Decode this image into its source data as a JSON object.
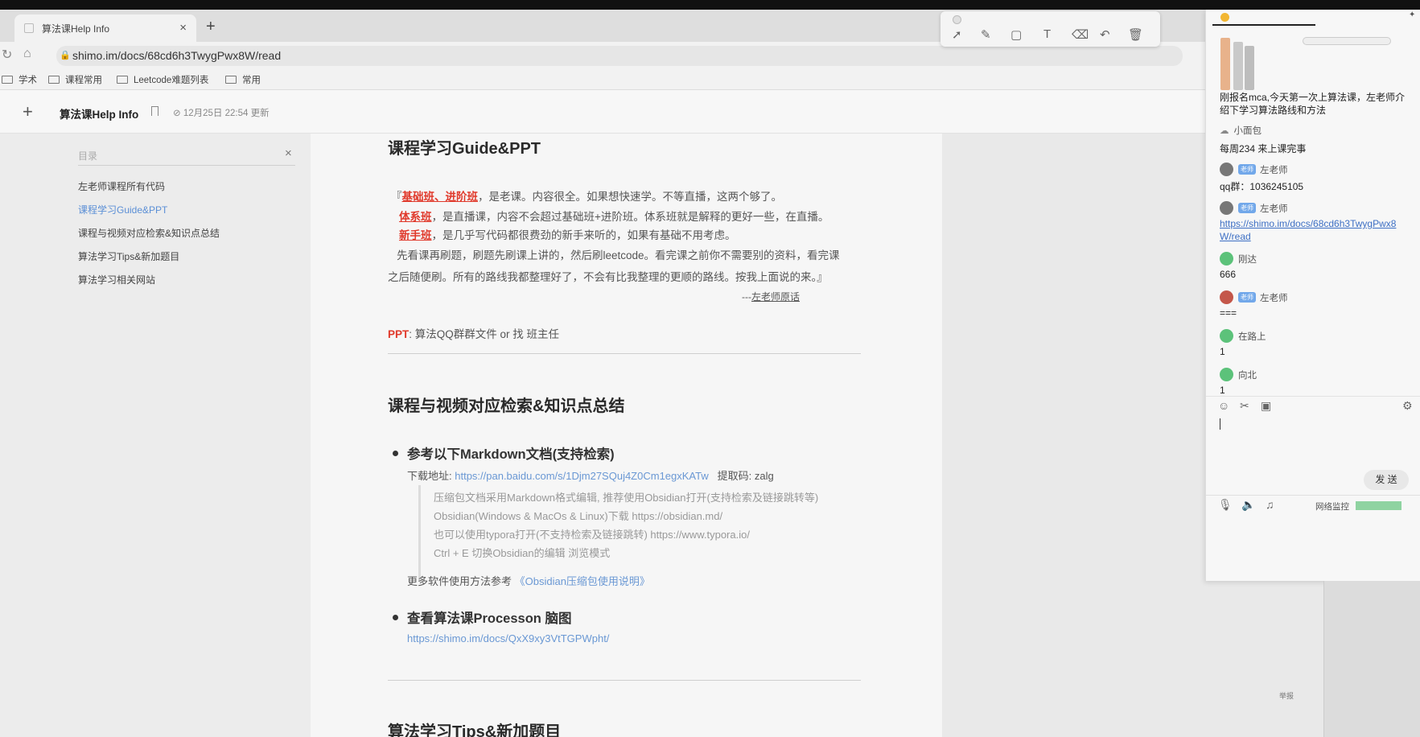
{
  "browser": {
    "tab_title": "算法课Help Info",
    "tab_close": "×",
    "new_tab": "+",
    "url": "shimo.im/docs/68cd6h3TwygPwx8W/read",
    "bookmarks": [
      "学术",
      "课程常用",
      "Leetcode难题列表",
      "常用"
    ]
  },
  "app": {
    "plus": "+",
    "title": "算法课Help Info",
    "updated": "12月25日 22:54 更新"
  },
  "toc": {
    "placeholder": "目录",
    "close": "×",
    "items": [
      "左老师课程所有代码",
      "课程学习Guide&PPT",
      "课程与视频对应检索&知识点总结",
      "算法学习Tips&新加题目",
      "算法学习相关网站"
    ],
    "active_index": 1
  },
  "doc": {
    "h_guide": "课程学习Guide&PPT",
    "q_open": "『",
    "q_basic": "基础班、进阶班",
    "q_basic_rest": "，是老课。内容很全。如果想快速学。不等直播，这两个够了。",
    "q_system": "体系班",
    "q_system_rest": "，是直播课，内容不会超过基础班+进阶班。体系班就是解释的更好一些，在直播。",
    "q_new": "新手班",
    "q_new_rest": "，是几乎写代码都很费劲的新手来听的，如果有基础不用考虑。",
    "q_line4": "先看课再刷题，刷题先刷课上讲的，然后刷leetcode。看完课之前你不需要别的资料，看完课",
    "q_line5": "之后随便刷。所有的路线我都整理好了，不会有比我整理的更顺的路线。按我上面说的来。』",
    "q_sign_dash": "---",
    "q_sign": "左老师原话",
    "ppt_label": "PPT",
    "ppt_text": ": 算法QQ群群文件 or 找 班主任",
    "h_course": "课程与视频对应检索&知识点总结",
    "b1_title": "参考以下Markdown文档(支持检索)",
    "b1_dl_label": "下载地址: ",
    "b1_dl_url": "https://pan.baidu.com/s/1Djm27SQuj4Z0Cm1egxKATw",
    "b1_code": "提取码: zalg",
    "quote1": "压缩包文档采用Markdown格式编辑, 推荐使用Obsidian打开(支持检索及链接跳转等)",
    "quote2": "Obsidian(Windows & MacOs & Linux)下载 https://obsidian.md/",
    "quote3": "也可以使用typora打开(不支持检索及链接跳转) https://www.typora.io/",
    "quote4": "Ctrl + E 切换Obsidian的编辑 浏览模式",
    "more_label": "更多软件使用方法参考 ",
    "more_link": "《Obsidian压缩包使用说明》",
    "b2_title": "查看算法课Processon 脑图",
    "b2_url": "https://shimo.im/docs/QxX9xy3VtTGPWpht/",
    "h_tips": "算法学习Tips&新加题目"
  },
  "chat": {
    "messages": [
      {
        "text": "刚报名mca,今天第一次上算法课，左老师介"
      },
      {
        "text": "绍下学习算法路线和方法"
      }
    ],
    "u1_name": "小面包",
    "u1_msg": "每周234 来上课完事",
    "teacher_badge": "老师",
    "teacher_name": "左老师",
    "t1_msg": "qq群：1036245105",
    "t2_link1": "https://shimo.im/docs/68cd6h3TwygPwx8",
    "t2_link2": "W/read",
    "u2_name": "刚达",
    "u2_msg": "666",
    "t3_msg": "===",
    "u3_name": "在路上",
    "u3_msg": "1",
    "u4_name": "向北",
    "u4_msg": "1",
    "send": "发 送",
    "netmon": "网络监控",
    "report": "举报"
  },
  "colors": {
    "accent_red": "#e0392b",
    "link_blue": "#6a98d4",
    "toc_active": "#5b8fd6",
    "teacher_badge": "#72a8ea",
    "online_green": "#5cc27a"
  }
}
